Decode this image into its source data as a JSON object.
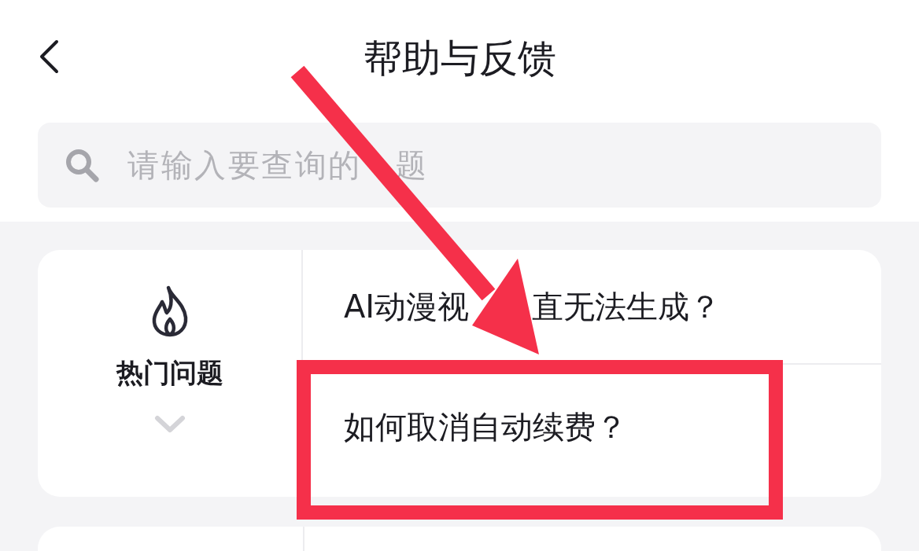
{
  "title": "帮助与反馈",
  "search": {
    "placeholder_parts": [
      "请输入要查询的",
      "题"
    ]
  },
  "faq_card": {
    "category": "热门问题",
    "expanded": false,
    "questions": [
      {
        "text_parts": [
          "AI动漫视",
          "直无法生成？"
        ],
        "highlighted": false
      },
      {
        "text_parts": [
          "如何取消自动续费？"
        ],
        "highlighted": true
      }
    ]
  }
}
